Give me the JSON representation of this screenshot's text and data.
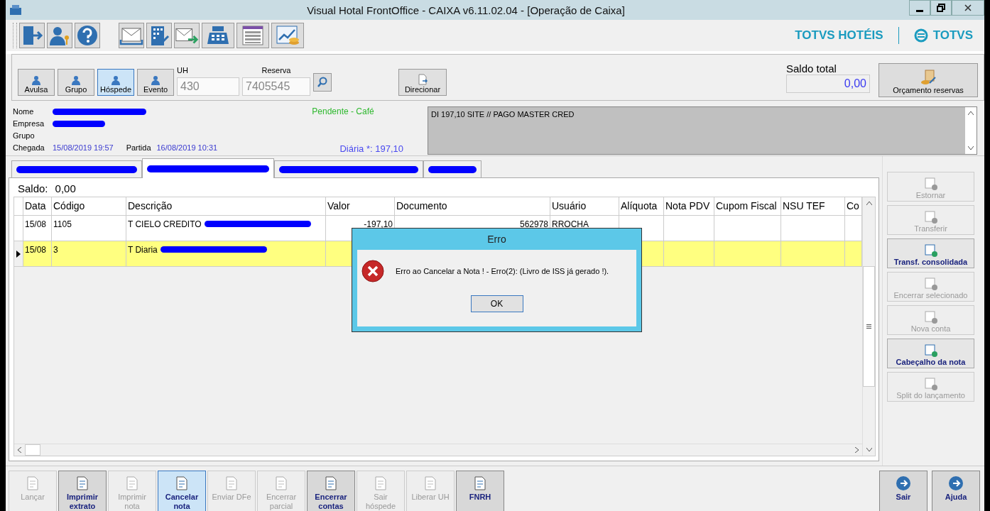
{
  "window": {
    "title": "Visual Hotal FrontOffice - CAIXA v6.11.02.04 - [Operação de Caixa]"
  },
  "brand": {
    "product": "TOTVS HOTÉIS",
    "company": "TOTVS"
  },
  "modes": [
    {
      "label": "Avulsa",
      "selected": false
    },
    {
      "label": "Grupo",
      "selected": false
    },
    {
      "label": "Hóspede",
      "selected": true
    },
    {
      "label": "Evento",
      "selected": false
    }
  ],
  "uh": {
    "label": "UH",
    "value": "430",
    "disabled": true
  },
  "reserva": {
    "label": "Reserva",
    "value": "7405545",
    "disabled": true
  },
  "direcionar": "Direcionar",
  "saldo_total": {
    "label": "Saldo total",
    "value": "0,00"
  },
  "orcamento": "Orçamento reservas",
  "guest": {
    "fields": [
      {
        "label": "Nome",
        "redacted": true
      },
      {
        "label": "Empresa",
        "redacted": true
      },
      {
        "label": "Grupo",
        "redacted": false
      }
    ],
    "chegada": {
      "label": "Chegada",
      "value": "15/08/2019 19:57"
    },
    "partida": {
      "label": "Partida",
      "value": "16/08/2019 10:31"
    },
    "status": "Pendente -  Café",
    "diaria": "Diária *: 197,10",
    "notes": "DI 197,10 SITE // PAGO MASTER CRED"
  },
  "tabs": [
    {
      "selected": false
    },
    {
      "selected": true
    },
    {
      "selected": false
    },
    {
      "selected": false
    }
  ],
  "saldo": {
    "label": "Saldo:",
    "value": "0,00"
  },
  "table": {
    "columns": [
      "Data",
      "Código",
      "Descrição",
      "Valor",
      "Documento",
      "Usuário",
      "Alíquota",
      "Nota PDV",
      "Cupom Fiscal",
      "NSU TEF",
      "Co"
    ],
    "rows": [
      {
        "selected": false,
        "cells": [
          "15/08",
          "1105",
          "T CIELO CREDITO",
          "-197,10",
          "562978",
          "RROCHA",
          "",
          "",
          "",
          "",
          ""
        ]
      },
      {
        "selected": true,
        "cells": [
          "15/08",
          "3",
          "T Diaria",
          "",
          "",
          "",
          "",
          "",
          "",
          "",
          ""
        ]
      }
    ]
  },
  "side_buttons": [
    {
      "label": "Estornar",
      "disabled": true
    },
    {
      "label": "Transferir",
      "disabled": true
    },
    {
      "label": "Transf. consolidada",
      "disabled": false
    },
    {
      "label": "Encerrar selecionado",
      "disabled": true
    },
    {
      "label": "Nova conta",
      "disabled": true
    },
    {
      "label": "Cabeçalho da nota",
      "disabled": false
    },
    {
      "label": "Split do lançamento",
      "disabled": true
    }
  ],
  "bottom_buttons": [
    {
      "label": "Lançar",
      "disabled": true,
      "selected": false
    },
    {
      "label": "Imprimir extrato",
      "disabled": false,
      "selected": false
    },
    {
      "label": "Imprimir nota",
      "disabled": true,
      "selected": false
    },
    {
      "label": "Cancelar nota",
      "disabled": false,
      "selected": true
    },
    {
      "label": "Enviar DFe",
      "disabled": true,
      "selected": false
    },
    {
      "label": "Encerrar parcial",
      "disabled": true,
      "selected": false
    },
    {
      "label": "Encerrar contas",
      "disabled": false,
      "selected": false
    },
    {
      "label": "Sair hóspede",
      "disabled": true,
      "selected": false
    },
    {
      "label": "Liberar UH",
      "disabled": true,
      "selected": false
    },
    {
      "label": "FNRH",
      "disabled": false,
      "selected": false
    }
  ],
  "exit_buttons": [
    {
      "label": "Sair"
    },
    {
      "label": "Ajuda"
    }
  ],
  "dialog": {
    "title": "Erro",
    "message": "Erro ao Cancelar a Nota ! - Erro(2): (Livro de ISS já gerado !).",
    "button": "OK"
  }
}
